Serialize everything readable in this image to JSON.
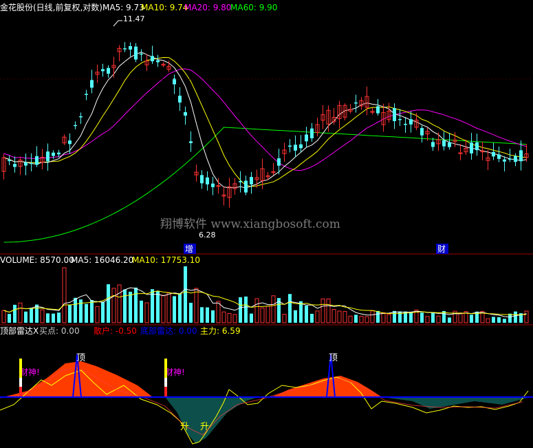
{
  "colors": {
    "bg": "#000000",
    "up": "#ff3232",
    "down": "#54fcfc",
    "ma5": "#ffffff",
    "ma10": "#ffff00",
    "ma20": "#ff00ff",
    "ma60": "#00ff00",
    "separator": "#a00000",
    "watermark": "#7a7a7a",
    "top_fill": "#ff3c00",
    "bottom_fill": "#0d4f4a",
    "top_signal": "#0000ff",
    "label_sanhu": "#ff0000",
    "label_bottom": "#0000ff",
    "label_main": "#ffff00",
    "label_buy": "#c8c8c8",
    "caishen": "#ff00ff",
    "sheng": "#ffff00"
  },
  "price_panel": {
    "title": "金花股份(日线,前复权,对数)",
    "ma5_label": "MA5: 9.73",
    "ma10_label": "MA10: 9.74",
    "ma20_label": "MA20: 9.80",
    "ma60_label": "MA60: 9.90",
    "high_label": "11.47",
    "low_label": "6.28",
    "watermark": "翔博软件 www.xiangbosoft.com",
    "marker_1": "增",
    "marker_2": "财"
  },
  "volume_panel": {
    "vol_label": "VOLUME: 8570.00",
    "ma5_label": "MA5: 16046.20",
    "ma10_label": "MA10: 17753.10"
  },
  "indicator_panel": {
    "name_label": "顶部雷达X",
    "buy_label": "买点: 0.00",
    "sanhu_label": "散户: -0.50",
    "bottom_label": "底部雷达: 0.00",
    "main_label": "主力: 6.59",
    "top_tag_1": "顶",
    "top_tag_2": "顶",
    "caishen_1": "财神!",
    "caishen_2": "财神!",
    "sheng_1": "升",
    "sheng_2": "升"
  },
  "chart_data": [
    {
      "type": "candlestick",
      "title": "金花股份(日线,前复权,对数)",
      "ma_values": {
        "MA5": 9.73,
        "MA10": 9.74,
        "MA20": 9.8,
        "MA60": 9.9
      },
      "annotated_high": 11.47,
      "annotated_low": 6.28,
      "ohlc_bars": 96,
      "note_series": "price read from candlestick rendering"
    },
    {
      "type": "bar",
      "title": "VOLUME",
      "values_summary": {
        "VOLUME": 8570.0,
        "MA5": 16046.2,
        "MA10": 17753.1
      }
    },
    {
      "type": "area",
      "title": "顶部雷达X",
      "values_summary": {
        "买点": 0.0,
        "散户": -0.5,
        "底部雷达": 0.0,
        "主力": 6.59
      }
    }
  ]
}
